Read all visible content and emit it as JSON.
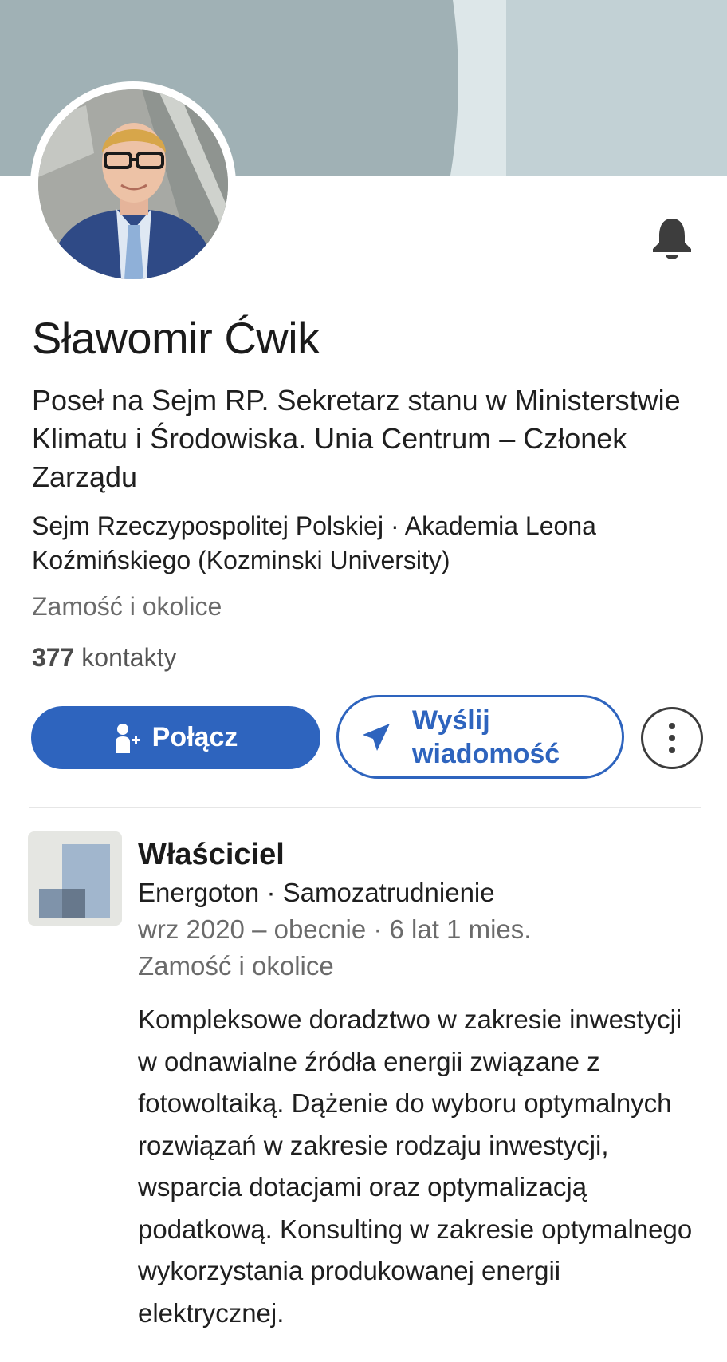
{
  "profile": {
    "name": "Sławomir Ćwik",
    "headline": "Poseł na Sejm RP. Sekretarz stanu w Ministerstwie Klimatu i Środowiska. Unia Centrum – Członek Zarządu",
    "organizations": "Sejm Rzeczypospolitej Polskiej · Akademia Leona Koźmińskiego (Kozminski University)",
    "location": "Zamość i okolice",
    "connections_count": "377",
    "connections_label": "kontakty"
  },
  "actions": {
    "connect_label": "Połącz",
    "message_label_line1": "Wyślij",
    "message_label_line2": "wiadomość"
  },
  "experience": {
    "title": "Właściciel",
    "company": "Energoton · Samozatrudnienie",
    "dates": "wrz 2020 – obecnie · 6 lat 1 mies.",
    "location": "Zamość i okolice",
    "description": "Kompleksowe doradztwo w zakresie inwestycji w odnawialne źródła energii związane z fotowoltaiką. Dążenie do wyboru optymalnych rozwiązań w zakresie rodzaju inwestycji, wsparcia dotacjami oraz optymalizacją podatkową. Konsulting w zakresie optymalnego wykorzystania produkowanej energii elektrycznej."
  },
  "icons": {
    "bell": "bell-icon",
    "connect": "add-person-icon",
    "message": "send-icon",
    "more": "more-vertical-icon"
  },
  "colors": {
    "primary": "#2e64be",
    "banner_light": "#c2d1d5",
    "banner_dark": "#a0b1b5",
    "muted_text": "#6b6b6b"
  }
}
